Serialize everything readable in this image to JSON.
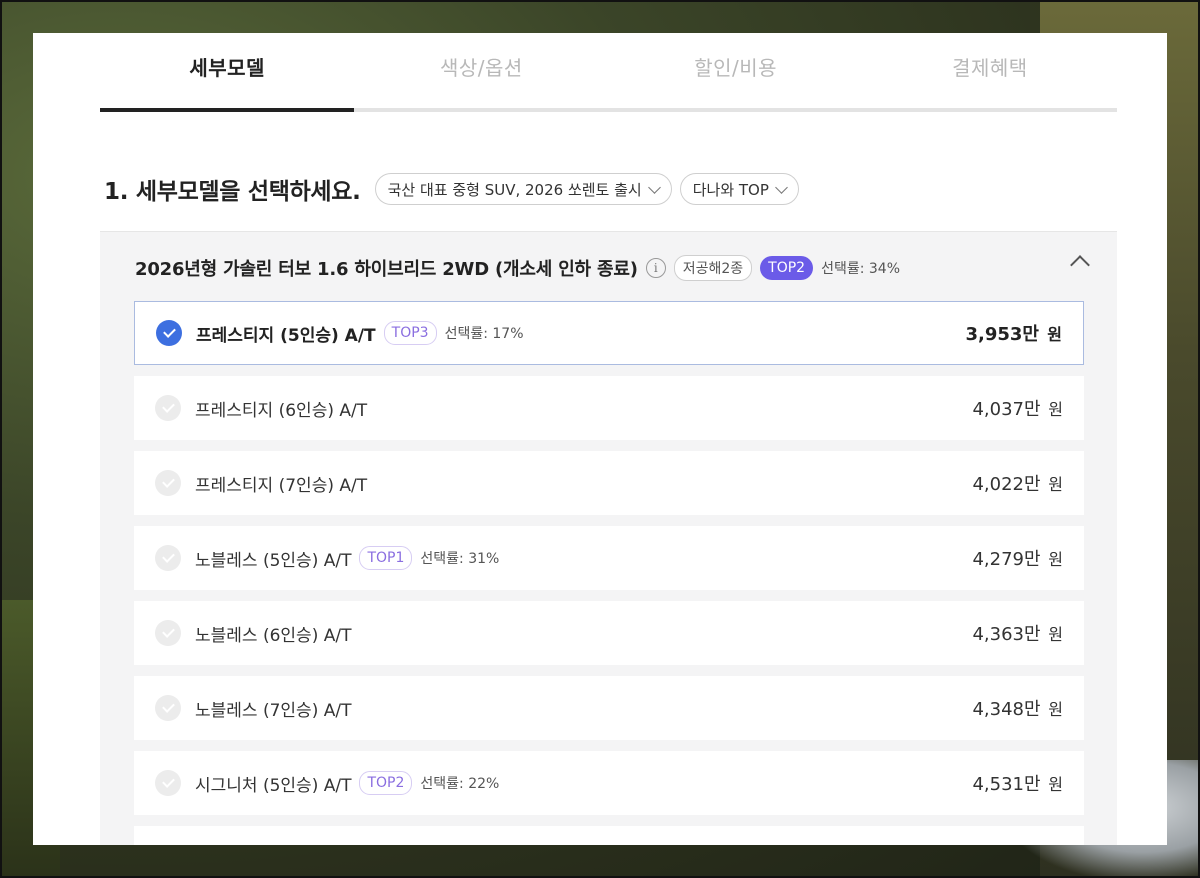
{
  "tabs": [
    {
      "label": "세부모델",
      "active": true
    },
    {
      "label": "색상/옵션",
      "active": false
    },
    {
      "label": "할인/비용",
      "active": false
    },
    {
      "label": "결제혜택",
      "active": false
    }
  ],
  "step": {
    "title": "1. 세부모델을 선택하세요.",
    "filter1": "국산 대표 중형 SUV, 2026 쏘렌토 출시",
    "filter2": "다나와 TOP"
  },
  "group": {
    "title": "2026년형 가솔린 터보 1.6 하이브리드 2WD (개소세 인하 종료)",
    "info": "i",
    "tag": "저공해2종",
    "top": "TOP2",
    "rate": "선택률: 34%"
  },
  "rows": [
    {
      "name": "프레스티지 (5인승) A/T",
      "top": "TOP3",
      "rate": "선택률: 17%",
      "price": "3,953만",
      "unit": "원",
      "selected": true
    },
    {
      "name": "프레스티지 (6인승) A/T",
      "top": "",
      "rate": "",
      "price": "4,037만",
      "unit": "원",
      "selected": false
    },
    {
      "name": "프레스티지 (7인승) A/T",
      "top": "",
      "rate": "",
      "price": "4,022만",
      "unit": "원",
      "selected": false
    },
    {
      "name": "노블레스 (5인승) A/T",
      "top": "TOP1",
      "rate": "선택률: 31%",
      "price": "4,279만",
      "unit": "원",
      "selected": false
    },
    {
      "name": "노블레스 (6인승) A/T",
      "top": "",
      "rate": "",
      "price": "4,363만",
      "unit": "원",
      "selected": false
    },
    {
      "name": "노블레스 (7인승) A/T",
      "top": "",
      "rate": "",
      "price": "4,348만",
      "unit": "원",
      "selected": false
    },
    {
      "name": "시그니처 (5인승) A/T",
      "top": "TOP2",
      "rate": "선택률: 22%",
      "price": "4,531만",
      "unit": "원",
      "selected": false
    }
  ]
}
